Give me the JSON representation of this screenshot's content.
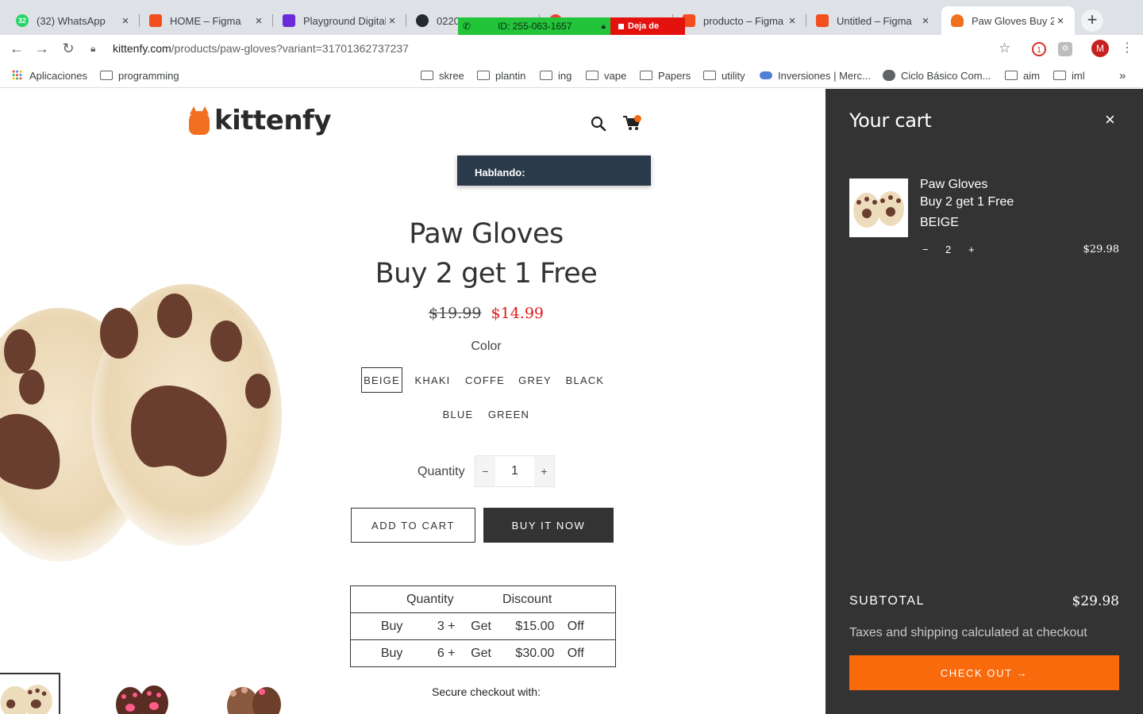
{
  "browser": {
    "tabs": [
      {
        "title": "(32) WhatsApp",
        "favicon": "whatsapp-icon",
        "color": "#25d366",
        "badge": "32"
      },
      {
        "title": "HOME – Figma",
        "favicon": "figma-icon",
        "color": "#f24e1e"
      },
      {
        "title": "Playground Digital",
        "favicon": "playground-icon",
        "color": "#6c2bd9"
      },
      {
        "title": "0220",
        "favicon": "github-icon",
        "color": "#24292e"
      },
      {
        "title": "",
        "favicon": "google-icon",
        "color": "#ea4335"
      },
      {
        "title": "producto – Figma",
        "favicon": "figma-icon",
        "color": "#f24e1e"
      },
      {
        "title": "Untitled – Figma",
        "favicon": "figma-icon",
        "color": "#f24e1e"
      },
      {
        "title": "Paw Gloves Buy 2",
        "favicon": "kittenfy-icon",
        "color": "#f07020"
      }
    ],
    "remote_session": {
      "id_text": "ID: 255-063-1657",
      "stop_text": "Deja de"
    },
    "url_host": "kittenfy.com",
    "url_rest": "/products/paw-gloves?variant=31701362737237",
    "extension_badge": "1",
    "avatar_letter": "M",
    "bookmarks": [
      {
        "label": "Aplicaciones",
        "type": "apps"
      },
      {
        "label": "programming",
        "type": "folder"
      },
      {
        "label": "skree",
        "type": "folder"
      },
      {
        "label": "plantin",
        "type": "folder"
      },
      {
        "label": "ing",
        "type": "folder"
      },
      {
        "label": "vape",
        "type": "folder"
      },
      {
        "label": "Papers",
        "type": "folder"
      },
      {
        "label": "utility",
        "type": "folder"
      },
      {
        "label": "Inversiones | Merc...",
        "type": "site"
      },
      {
        "label": "Ciclo Básico Com...",
        "type": "site"
      },
      {
        "label": "aim",
        "type": "folder"
      },
      {
        "label": "iml",
        "type": "folder"
      }
    ],
    "bookmarks_overflow": "»"
  },
  "store": {
    "logo_text": "kittenfy",
    "tooltip": "Hablando:",
    "product": {
      "title_line1": "Paw Gloves",
      "title_line2": "Buy 2 get 1 Free",
      "price_old": "$19.99",
      "price_new": "$14.99",
      "color_label": "Color",
      "colors": [
        "BEIGE",
        "KHAKI",
        "COFFE",
        "GREY",
        "BLACK",
        "BLUE",
        "GREEN"
      ],
      "selected_color": "BEIGE",
      "quantity_label": "Quantity",
      "quantity": "1",
      "minus": "−",
      "plus": "+",
      "add_to_cart": "ADD TO CART",
      "buy_now": "BUY IT NOW"
    },
    "discount_table": {
      "headers": [
        "Quantity",
        "Discount"
      ],
      "rows": [
        [
          "Buy",
          "3 +",
          "Get",
          "$15.00",
          "Off"
        ],
        [
          "Buy",
          "6 +",
          "Get",
          "$30.00",
          "Off"
        ]
      ]
    },
    "secure_checkout": "Secure checkout with:",
    "colors": {
      "sale_price": "#e21b1b",
      "accent": "#f96a0c"
    }
  },
  "cart": {
    "title": "Your cart",
    "close": "×",
    "item": {
      "name_line1": "Paw Gloves",
      "name_line2": "Buy 2 get 1 Free",
      "variant": "BEIGE",
      "quantity": "2",
      "minus": "−",
      "plus": "+",
      "price": "$29.98"
    },
    "subtotal_label": "SUBTOTAL",
    "subtotal_value": "$29.98",
    "tax_note": "Taxes and shipping calculated at checkout",
    "checkout": "CHECK OUT →"
  }
}
